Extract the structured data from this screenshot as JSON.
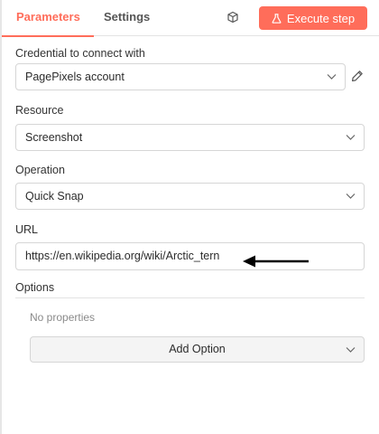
{
  "tabs": {
    "parameters": "Parameters",
    "settings": "Settings"
  },
  "execute_button": {
    "label": "Execute step"
  },
  "fields": {
    "credential": {
      "label": "Credential to connect with",
      "value": "PagePixels account"
    },
    "resource": {
      "label": "Resource",
      "value": "Screenshot"
    },
    "operation": {
      "label": "Operation",
      "value": "Quick Snap"
    },
    "url": {
      "label": "URL",
      "value": "https://en.wikipedia.org/wiki/Arctic_tern"
    }
  },
  "options": {
    "label": "Options",
    "empty_text": "No properties",
    "add_button": "Add Option"
  },
  "colors": {
    "accent": "#ff6d5a",
    "border": "#d6d6d6",
    "muted_text": "#8a8a8a"
  },
  "icons": [
    "cube-icon",
    "flask-icon",
    "chevron-down-icon",
    "pencil-icon",
    "arrow-left-icon"
  ]
}
